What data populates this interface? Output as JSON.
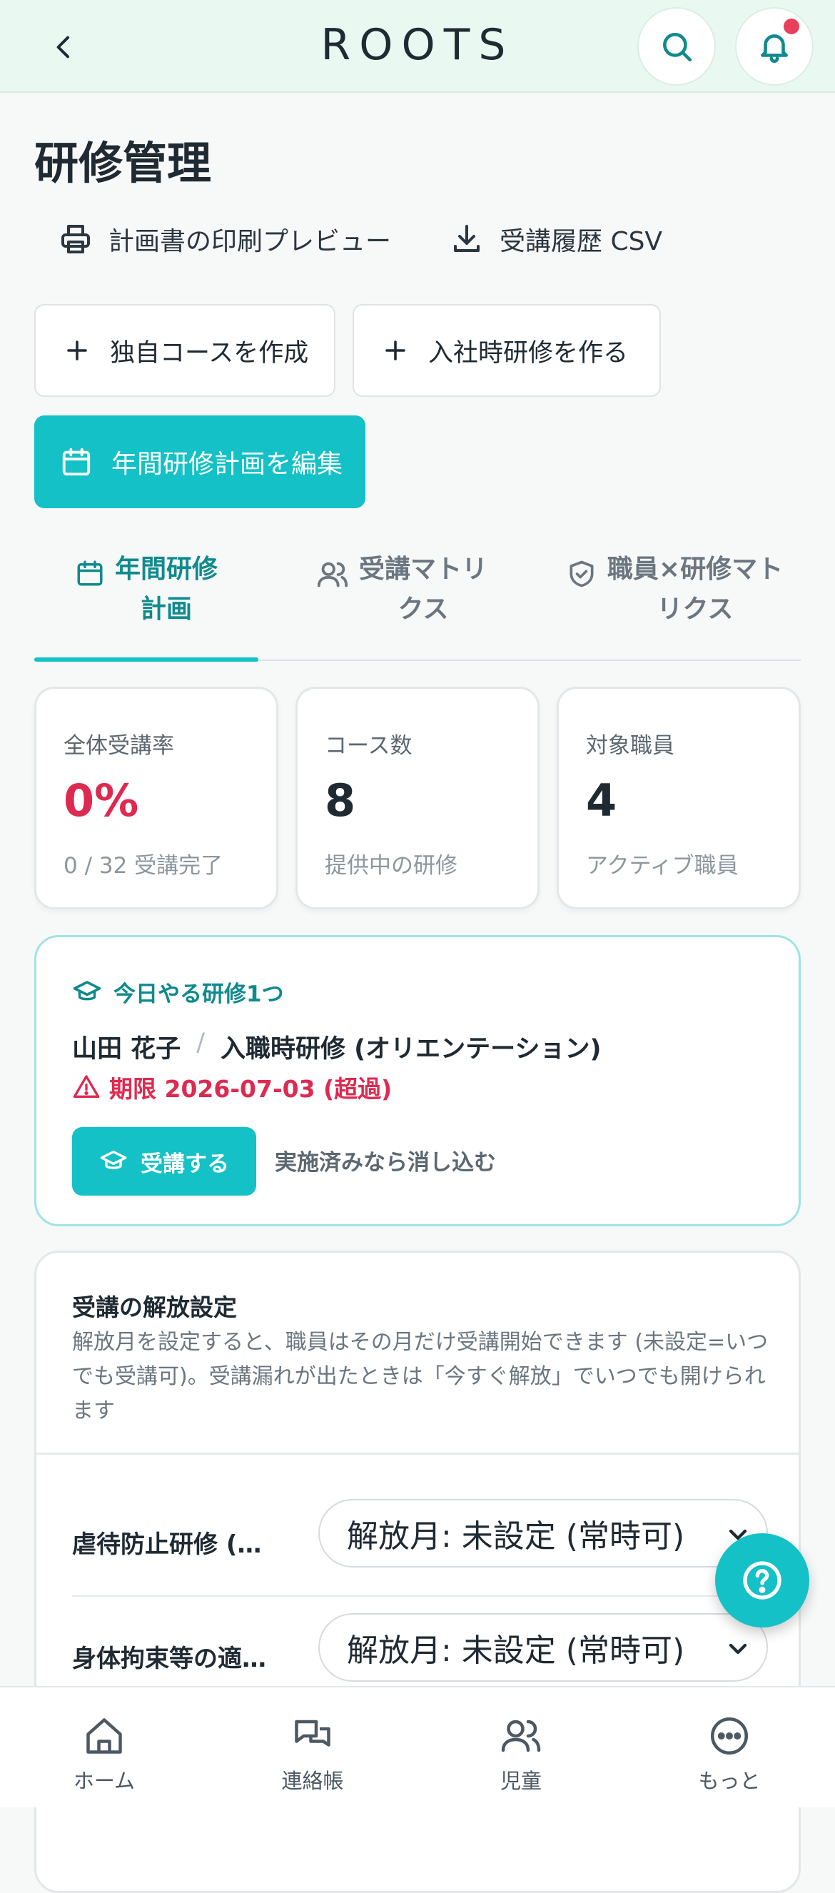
{
  "header": {
    "app_title": "ROOTS",
    "icons": {
      "back": "chevron-left-icon",
      "search": "search-icon",
      "notifications": "bell-icon"
    },
    "has_unread": true
  },
  "page": {
    "title": "研修管理"
  },
  "actions": {
    "print_preview": "計画書の印刷プレビュー",
    "csv_export": "受講履歴 CSV",
    "create_custom_course": "独自コースを作成",
    "create_onboarding": "入社時研修を作る",
    "edit_annual_plan": "年間研修計画を編集"
  },
  "tabs": [
    {
      "label": "年間研修\n計画",
      "icon": "calendar-icon",
      "active": true
    },
    {
      "label": "受講マトリ\nクス",
      "icon": "users-icon",
      "active": false
    },
    {
      "label": "職員×研修マト\nリクス",
      "icon": "shield-check-icon",
      "active": false
    }
  ],
  "stats": [
    {
      "label": "全体受講率",
      "value": "0%",
      "sub": "0 / 32 受講完了"
    },
    {
      "label": "コース数",
      "value": "8",
      "sub": "提供中の研修"
    },
    {
      "label": "対象職員",
      "value": "4",
      "sub": "アクティブ職員"
    }
  ],
  "today": {
    "heading": "今日やる研修1つ",
    "staff_name": "山田 花子",
    "separator": "/",
    "course": "入職時研修 (オリエンテーション)",
    "deadline": "期限 2026-07-03 (超過)",
    "attend_label": "受講する",
    "mark_done_label": "実施済みなら消し込む"
  },
  "release": {
    "title": "受講の解放設定",
    "description": "解放月を設定すると、職員はその月だけ受講開始できます (未設定=いつでも受講可)。受講漏れが出たときは「今すぐ解放」でいつでも開けられます",
    "rows": [
      {
        "course": "虐待防止研修 (…",
        "select_value": "解放月: 未設定 (常時可)"
      },
      {
        "course": "身体拘束等の適…",
        "select_value": "解放月: 未設定 (常時可)"
      }
    ]
  },
  "nav": {
    "home": "ホーム",
    "contact_book": "連絡帳",
    "children": "児童",
    "more": "もっと"
  },
  "colors": {
    "accent": "#13c1c6",
    "accent_dark": "#0f8a8e",
    "danger": "#de2a50",
    "header_bg": "#eaf8f2"
  }
}
